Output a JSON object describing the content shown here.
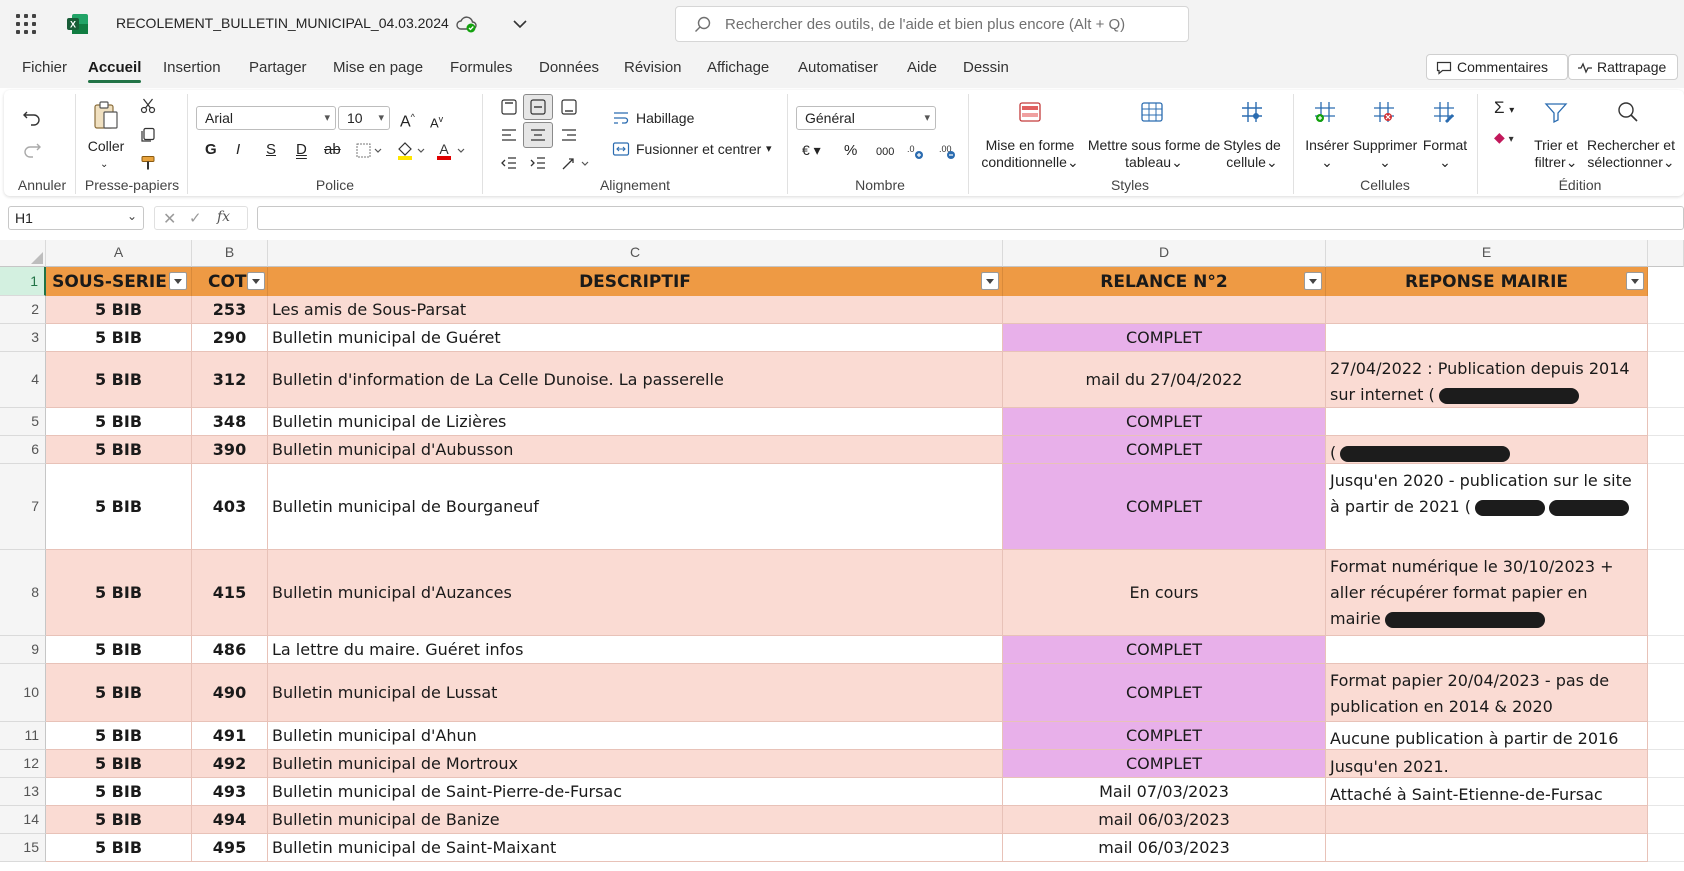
{
  "titlebar": {
    "doc_title": "RECOLEMENT_BULLETIN_MUNICIPAL_04.03.2024",
    "search_placeholder": "Rechercher des outils, de l'aide et bien plus encore (Alt + Q)"
  },
  "menu": {
    "tabs": [
      "Fichier",
      "Accueil",
      "Insertion",
      "Partager",
      "Mise en page",
      "Formules",
      "Données",
      "Révision",
      "Affichage",
      "Automatiser",
      "Aide",
      "Dessin"
    ],
    "active": "Accueil",
    "comments_label": "Commentaires",
    "catchup_label": "Rattrapage"
  },
  "ribbon": {
    "undo_group": "Annuler",
    "clipboard": {
      "paste": "Coller",
      "group": "Presse-papiers"
    },
    "font": {
      "name": "Arial",
      "size": "10",
      "group": "Police",
      "bold": "G",
      "italic": "I",
      "underline": "S",
      "double_underline": "D",
      "strike": "ab"
    },
    "alignment": {
      "wrap": "Habillage",
      "merge": "Fusionner et centrer",
      "group": "Alignement"
    },
    "number": {
      "format": "Général",
      "currency": "€",
      "percent": "%",
      "thousands": "000",
      "group": "Nombre"
    },
    "styles": {
      "cond_format_1": "Mise en forme",
      "cond_format_2": "conditionnelle",
      "table_1": "Mettre sous forme de",
      "table_2": "tableau",
      "cell_styles_1": "Styles de",
      "cell_styles_2": "cellule",
      "group": "Styles"
    },
    "cells": {
      "insert": "Insérer",
      "delete": "Supprimer",
      "format": "Format",
      "group": "Cellules"
    },
    "editing": {
      "sort_1": "Trier et",
      "sort_2": "filtrer",
      "find_1": "Rechercher et",
      "find_2": "sélectionner",
      "group": "Édition"
    }
  },
  "formula_bar": {
    "name_box": "H1",
    "formula": ""
  },
  "sheet": {
    "columns": [
      "A",
      "B",
      "C",
      "D",
      "E"
    ],
    "headers": [
      "SOUS-SERIE",
      "COTE",
      "DESCRIPTIF",
      "RELANCE N°2",
      "REPONSE MAIRIE"
    ],
    "rows": [
      {
        "num": "2",
        "a": "5 BIB",
        "b": "253",
        "c": "Les amis de Sous-Parsat",
        "d": "",
        "e": ""
      },
      {
        "num": "3",
        "a": "5 BIB",
        "b": "290",
        "c": "Bulletin municipal de Guéret",
        "d": "COMPLET",
        "e": ""
      },
      {
        "num": "4",
        "a": "5 BIB",
        "b": "312",
        "c": "Bulletin d'information de La Celle Dunoise. La passerelle",
        "d": "mail du 27/04/2022",
        "e": "27/04/2022 : Publication depuis 2014 sur internet ("
      },
      {
        "num": "5",
        "a": "5 BIB",
        "b": "348",
        "c": "Bulletin municipal de Lizières",
        "d": "COMPLET",
        "e": ""
      },
      {
        "num": "6",
        "a": "5 BIB",
        "b": "390",
        "c": "Bulletin municipal d'Aubusson",
        "d": "COMPLET",
        "e": "("
      },
      {
        "num": "7",
        "a": "5 BIB",
        "b": "403",
        "c": "Bulletin municipal de Bourganeuf",
        "d": "COMPLET",
        "e": "Jusqu'en 2020 - publication sur le site à partir de 2021 ("
      },
      {
        "num": "8",
        "a": "5 BIB",
        "b": "415",
        "c": "Bulletin municipal d'Auzances",
        "d": "En cours",
        "e": "Format numérique  le 30/10/2023 + aller récupérer format papier en mairie"
      },
      {
        "num": "9",
        "a": "5 BIB",
        "b": "486",
        "c": "La lettre du maire. Guéret infos",
        "d": "COMPLET",
        "e": ""
      },
      {
        "num": "10",
        "a": "5 BIB",
        "b": "490",
        "c": "Bulletin municipal de Lussat",
        "d": "COMPLET",
        "e": "Format papier 20/04/2023 - pas de publication en 2014 & 2020"
      },
      {
        "num": "11",
        "a": "5 BIB",
        "b": "491",
        "c": "Bulletin municipal d'Ahun",
        "d": "COMPLET",
        "e": "Aucune publication à partir de 2016"
      },
      {
        "num": "12",
        "a": "5 BIB",
        "b": "492",
        "c": "Bulletin municipal de Mortroux",
        "d": "COMPLET",
        "e": "Jusqu'en 2021."
      },
      {
        "num": "13",
        "a": "5 BIB",
        "b": "493",
        "c": "Bulletin municipal de Saint-Pierre-de-Fursac",
        "d": "Mail 07/03/2023",
        "e": "Attaché à Saint-Etienne-de-Fursac"
      },
      {
        "num": "14",
        "a": "5 BIB",
        "b": "494",
        "c": "Bulletin municipal de Banize",
        "d": "mail 06/03/2023",
        "e": ""
      },
      {
        "num": "15",
        "a": "5 BIB",
        "b": "495",
        "c": "Bulletin municipal de Saint-Maixant",
        "d": "mail 06/03/2023",
        "e": ""
      }
    ]
  },
  "colors": {
    "accent": "#217346",
    "header_fill": "#ee9a44",
    "stripe": "#fadbd3",
    "complet_fill": "#e8b0ea"
  }
}
